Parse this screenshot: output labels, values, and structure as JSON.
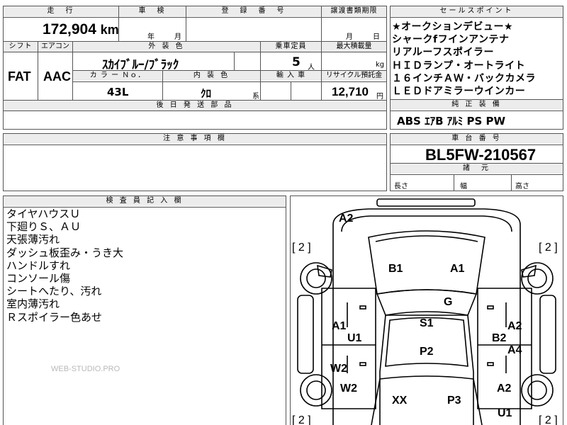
{
  "header": {
    "mileage_label": "走　行",
    "inspection_label": "車　検",
    "registration_label": "登　録　番　号",
    "transfer_label": "譲渡書類期限",
    "sales_points_label": "セールスポイント",
    "mileage_value": "172,904",
    "mileage_unit": "km",
    "year_unit": "年",
    "month_unit": "月",
    "transfer_month_unit": "月",
    "transfer_day_unit": "日"
  },
  "specs": {
    "shift_label": "シフト",
    "aircon_label": "エアコン",
    "exterior_label": "外 装 色",
    "capacity_label": "乗車定員",
    "max_load_label": "最大積載量",
    "shift_value": "FAT",
    "aircon_value": "AAC",
    "exterior_value": "ｽｶｲﾌﾞﾙｰ/ﾌﾞﾗｯｸ",
    "capacity_value": "5",
    "capacity_unit": "人",
    "load_unit": "kg",
    "color_no_label": "カ ラ ー Ｎｏ．",
    "interior_label": "内 装 色",
    "import_label": "輸 入 車",
    "recycle_label": "リサイクル預託金",
    "color_no_value": "43L",
    "interior_value": "ｸﾛ",
    "interior_suffix": "系",
    "recycle_value": "12,710",
    "recycle_unit": "円",
    "parts_label": "後 日 発 送 部 品"
  },
  "sales_points": [
    "★オークションデビュー★",
    "シャークfフインアンテナ",
    "リアルーフスポイラー",
    "ＨＩＤランプ・オートライト",
    "１６インチＡＷ・バックカメラ",
    "ＬＥＤドアミラーウインカー"
  ],
  "equipment": {
    "label": "純 正 装 備",
    "value": "ABS  ｴｱB  ｱﾙﾐ  PS  PW"
  },
  "caution": {
    "label": "注 意 事 項 欄"
  },
  "chassis": {
    "label": "車 台 番 号",
    "value": "BL5FW-210567",
    "specs_label": "諸　元",
    "length_label": "長さ",
    "width_label": "幅",
    "height_label": "高さ"
  },
  "inspector": {
    "label": "検 査 員 記 入 欄",
    "notes": [
      "タイヤハウスＵ",
      "下廻りＳ、ＡＵ",
      "天張薄汚れ",
      "ダッシュ板歪み・うき大",
      "ハンドルすれ",
      "コンソール傷",
      "シートへたり、汚れ",
      "室内薄汚れ",
      "Ｒスポイラー色あせ"
    ],
    "watermark": "WEB-STUDIO.PRO"
  },
  "diagram": {
    "tire_fl": "[ 2 ]",
    "tire_fr": "[ 2 ]",
    "tire_rl": "[ 2 ]",
    "tire_rr": "[ 2 ]",
    "codes": {
      "front_bumper": "A2",
      "hood_left": "B1",
      "hood_right": "A1",
      "windshield": "G",
      "roof_front": "S1",
      "roof_rear": "P2",
      "left_front_door_1": "A1",
      "left_front_door_2": "U1",
      "right_front_door_1": "A2",
      "right_front_door_2": "B2",
      "right_front_door_3": "A4",
      "left_rear_door": "W2",
      "left_rear_fender": "W2",
      "right_rear_fender": "A2",
      "rear_glass_left": "XX",
      "rear_glass_right": "P3",
      "rear_right": "U1"
    }
  }
}
